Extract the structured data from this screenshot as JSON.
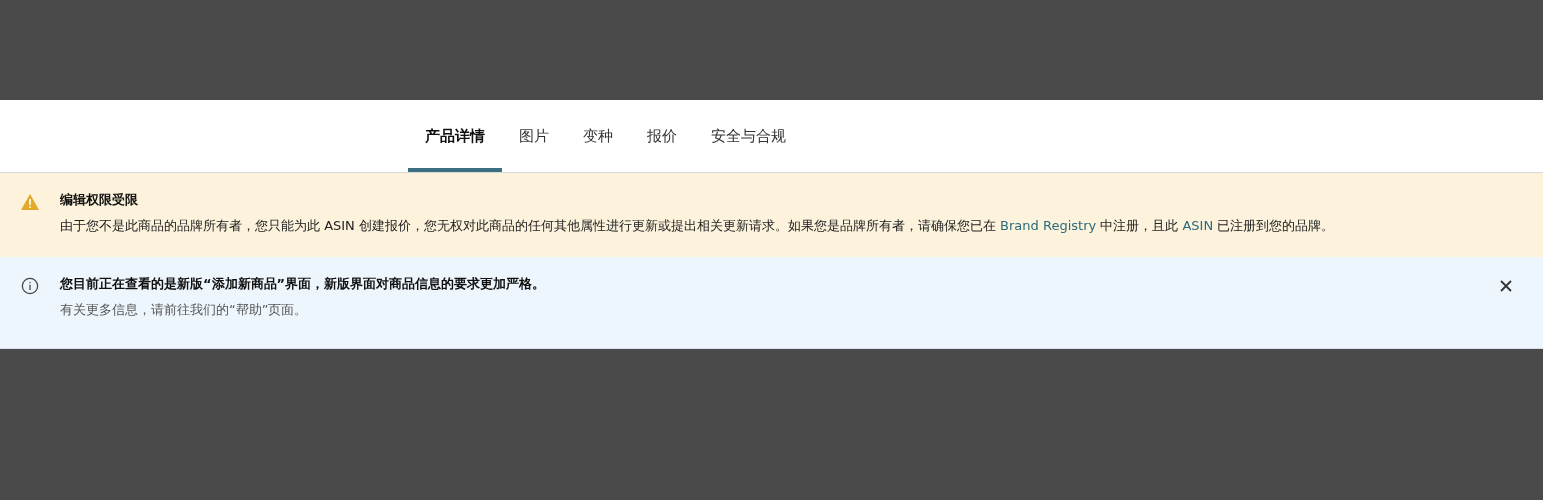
{
  "tabs": [
    {
      "label": "产品详情",
      "selected": true
    },
    {
      "label": "图片",
      "selected": false
    },
    {
      "label": "变种",
      "selected": false
    },
    {
      "label": "报价",
      "selected": false
    },
    {
      "label": "安全与合规",
      "selected": false
    }
  ],
  "alerts": [
    {
      "kind": "warning",
      "title": "编辑权限受限",
      "body": [
        {
          "kind": "text",
          "text": "由于您不是此商品的品牌所有者，您只能为此 ASIN 创建报价，您无权对此商品的任何其他属性进行更新或提出相关更新请求。如果您是品牌所有者，请确保您已在 "
        },
        {
          "kind": "link",
          "text": "Brand Registry"
        },
        {
          "kind": "text",
          "text": " 中注册，且此 "
        },
        {
          "kind": "link",
          "text": "ASIN"
        },
        {
          "kind": "text",
          "text": " 已注册到您的品牌。"
        }
      ],
      "dismissible": false
    },
    {
      "kind": "info",
      "title": "您目前正在查看的是新版“添加新商品”界面，新版界面对商品信息的要求更加严格。",
      "body": [
        {
          "kind": "text",
          "text": "有关更多信息，请前往我们的“帮助”页面。"
        }
      ],
      "dismissible": true
    }
  ]
}
